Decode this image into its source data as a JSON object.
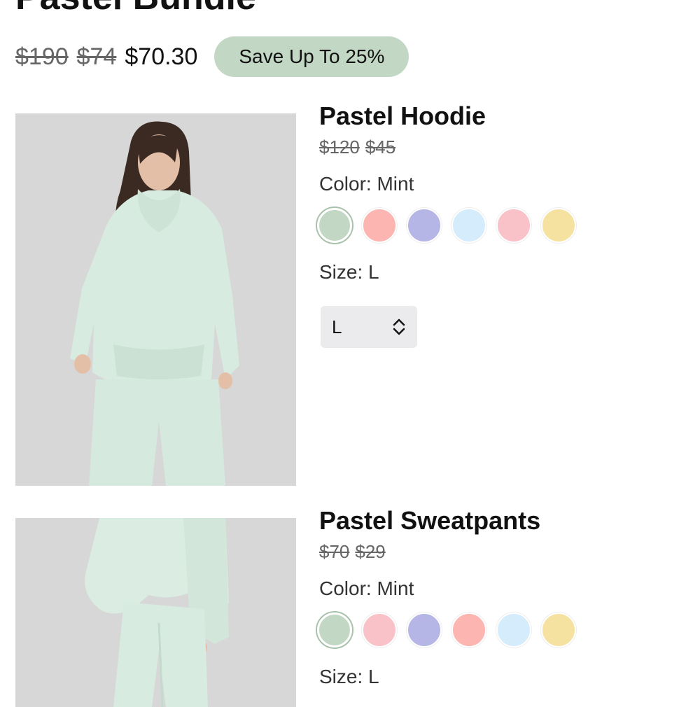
{
  "bundle": {
    "title": "Pastel Bundle",
    "original_price": "$190",
    "sale_price": "$74",
    "bundle_price": "$70.30",
    "save_badge": "Save Up To 25%"
  },
  "colors": {
    "badge_bg": "#c3d8c4",
    "select_bg": "#ebebed"
  },
  "products": [
    {
      "name": "Pastel Hoodie",
      "original_price": "$120",
      "sale_price": "$45",
      "color_label": "Color: Mint",
      "size_label": "Size: L",
      "size_value": "L",
      "swatches": [
        {
          "color": "#c3d8c4",
          "selected": true
        },
        {
          "color": "#fcb5b0"
        },
        {
          "color": "#b6b6e6"
        },
        {
          "color": "#d4ecfb"
        },
        {
          "color": "#f8c2c8"
        },
        {
          "color": "#f6e2a0"
        }
      ]
    },
    {
      "name": "Pastel Sweatpants",
      "original_price": "$70",
      "sale_price": "$29",
      "color_label": "Color: Mint",
      "size_label": "Size: L",
      "swatches": [
        {
          "color": "#c3d8c4",
          "selected": true
        },
        {
          "color": "#f8c2c8"
        },
        {
          "color": "#b6b6e6"
        },
        {
          "color": "#fcb5b0"
        },
        {
          "color": "#d4ecfb"
        },
        {
          "color": "#f6e2a0"
        }
      ]
    }
  ],
  "icons": {
    "select_chevron": "chevron-up-down-icon"
  }
}
